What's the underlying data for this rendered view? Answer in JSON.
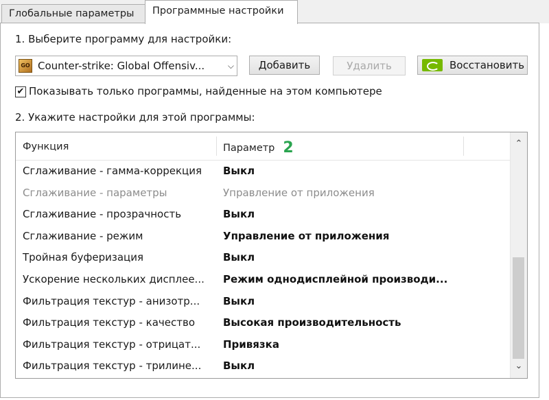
{
  "tabs": [
    {
      "label": "Глобальные параметры",
      "active": false
    },
    {
      "label": "Программные настройки",
      "active": true
    }
  ],
  "step1": {
    "label": "1. Выберите программу для настройки:"
  },
  "program_select": {
    "value": "Counter-strike: Global Offensiv...",
    "icon": "csgo-app-icon",
    "icon_text": "GO"
  },
  "buttons": {
    "add": "Добавить",
    "remove": "Удалить",
    "restore": "Восстановить"
  },
  "checkbox": {
    "checked": true,
    "label": "Показывать только программы, найденные на этом компьютере"
  },
  "step2": {
    "label": "2. Укажите настройки для этой программы:"
  },
  "table": {
    "columns": [
      "Функция",
      "Параметр"
    ],
    "badge": "2",
    "rows": [
      {
        "function": "Сглаживание - гамма-коррекция",
        "value": "Выкл",
        "disabled": false
      },
      {
        "function": "Сглаживание - параметры",
        "value": "Управление от приложения",
        "disabled": true
      },
      {
        "function": "Сглаживание - прозрачность",
        "value": "Выкл",
        "disabled": false
      },
      {
        "function": "Сглаживание - режим",
        "value": "Управление от приложения",
        "disabled": false
      },
      {
        "function": "Тройная буферизация",
        "value": "Выкл",
        "disabled": false
      },
      {
        "function": "Ускорение нескольких дисплее...",
        "value": "Режим однодисплейной производи...",
        "disabled": false
      },
      {
        "function": "Фильтрация текстур - анизотр...",
        "value": "Выкл",
        "disabled": false
      },
      {
        "function": "Фильтрация текстур - качество",
        "value": "Высокая производительность",
        "disabled": false
      },
      {
        "function": "Фильтрация текстур - отрицат...",
        "value": "Привязка",
        "disabled": false
      },
      {
        "function": "Фильтрация текстур - трилине...",
        "value": "Выкл",
        "disabled": false
      }
    ]
  },
  "scrollbar": {
    "up_glyph": "⌃",
    "down_glyph": "⌄"
  },
  "colors": {
    "badge": "#2aa44f",
    "nvidia_green": "#76b900",
    "disabled_text": "#8c8c8c"
  }
}
